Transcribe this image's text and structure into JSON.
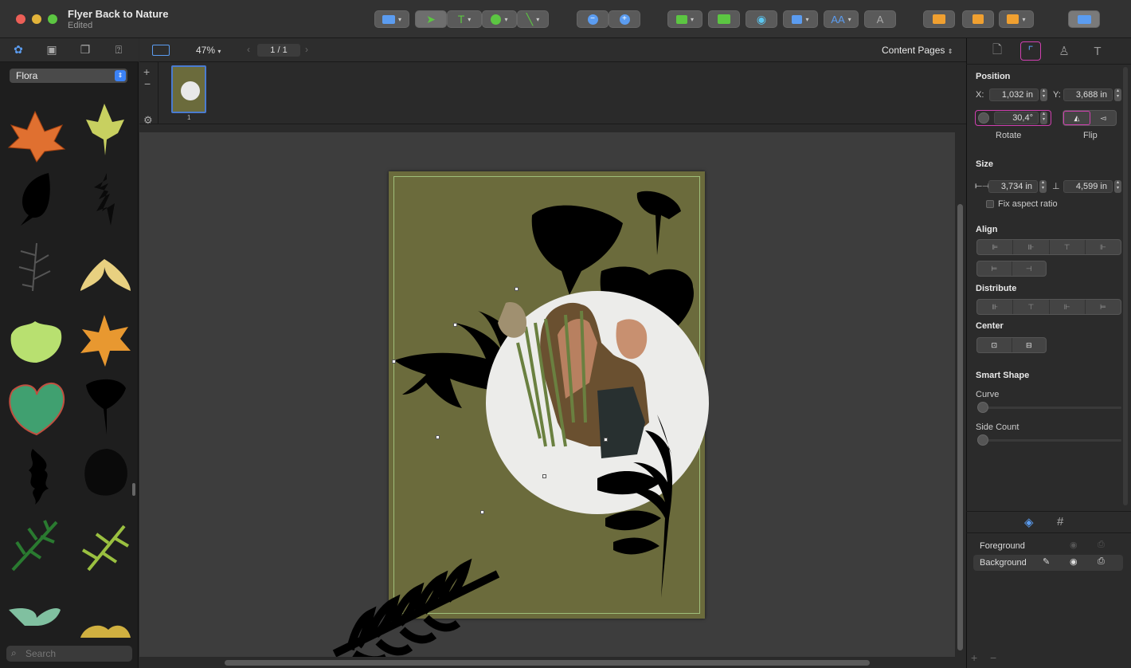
{
  "window": {
    "title": "Flyer Back to Nature",
    "subtitle": "Edited"
  },
  "toolbar": {
    "colors": {
      "close": "#ec5f57",
      "minimize": "#e2b33a",
      "zoom": "#5cc642",
      "accent": "#3b82f6"
    },
    "icons": [
      "layout-icon",
      "pointer-icon",
      "text-icon",
      "shape-icon",
      "line-icon",
      "zoom-out-icon",
      "zoom-in-icon",
      "image-icon",
      "print-icon",
      "preview-icon",
      "insert-icon",
      "text-style-icon",
      "font-icon",
      "grid-icon",
      "calendar-icon",
      "contact-icon",
      "window-icon"
    ]
  },
  "library": {
    "tabs": [
      "shapes-icon",
      "images-icon",
      "copies-icon",
      "text-icon"
    ],
    "category": "Flora",
    "search_placeholder": "Search",
    "items": [
      "maple-leaf",
      "yellow-leaf",
      "black-leaf",
      "black-fern",
      "grey-fern",
      "seed-pod",
      "lettuce",
      "orange-maple",
      "green-heart-leaf",
      "ginkgo",
      "oak-leaf",
      "round-leaf",
      "green-branch",
      "yellow-branch",
      "two-leaves",
      "berries"
    ]
  },
  "docbar": {
    "zoom": "47%",
    "page": "1 / 1",
    "view": "Content Pages"
  },
  "thumbnails": {
    "pages": [
      "1"
    ]
  },
  "inspector": {
    "position_title": "Position",
    "x_label": "X:",
    "x_value": "1,032 in",
    "y_label": "Y:",
    "y_value": "3,688 in",
    "rotate_value": "30,4°",
    "rotate_label": "Rotate",
    "flip_label": "Flip",
    "size_title": "Size",
    "width_value": "3,734 in",
    "height_value": "4,599 in",
    "fix_aspect": "Fix aspect ratio",
    "align_title": "Align",
    "distribute_title": "Distribute",
    "center_title": "Center",
    "smart_shape_title": "Smart Shape",
    "curve_label": "Curve",
    "side_count_label": "Side Count",
    "layers": [
      {
        "name": "Foreground"
      },
      {
        "name": "Background"
      }
    ]
  }
}
